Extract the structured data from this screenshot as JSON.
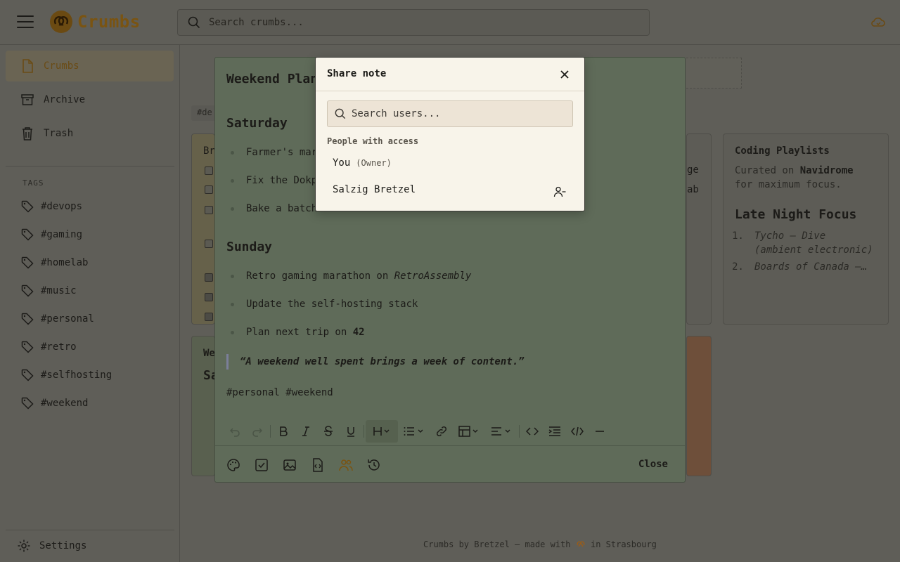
{
  "app": {
    "name": "Crumbs",
    "search_placeholder": "Search crumbs..."
  },
  "sidebar": {
    "items": [
      {
        "label": "Crumbs",
        "icon": "note-icon"
      },
      {
        "label": "Archive",
        "icon": "archive-icon"
      },
      {
        "label": "Trash",
        "icon": "trash-icon"
      }
    ],
    "tags_heading": "TAGS",
    "tags": [
      "#devops",
      "#gaming",
      "#homelab",
      "#music",
      "#personal",
      "#retro",
      "#selfhosting",
      "#weekend"
    ],
    "settings_label": "Settings"
  },
  "background": {
    "chip": "#de",
    "yellow_peek": "Br",
    "green_peek_1": "We",
    "green_peek_2": "Sa",
    "grey_peek_1": "ge",
    "grey_peek_2": "ab",
    "coding": {
      "title": "Coding Playlists",
      "sub_before": "Curated on ",
      "sub_bold": "Navidrome",
      "sub_after": " for maximum focus.",
      "heading": "Late Night Focus",
      "items": [
        {
          "num": "1.",
          "text": "Tycho — Dive (ambient electronic)"
        },
        {
          "num": "2.",
          "text": "Boards of Canada —…"
        }
      ]
    }
  },
  "editor": {
    "title": "Weekend Plans",
    "saturday_heading": "Saturday",
    "saturday_items": [
      "Farmer's market",
      "Fix the Dokploy",
      "Bake a batch"
    ],
    "sunday_heading": "Sunday",
    "sunday_items": [
      {
        "text": "Retro gaming marathon on ",
        "em": "RetroAssembly"
      },
      {
        "text": "Update the self-hosting stack",
        "em": ""
      },
      {
        "text": "Plan next trip on ",
        "bold": "42"
      }
    ],
    "quote": "“A weekend well spent brings a week of content.”",
    "tags_line": "#personal #weekend",
    "close_label": "Close"
  },
  "share_modal": {
    "title": "Share note",
    "search_placeholder": "Search users...",
    "access_label": "People with access",
    "people": [
      {
        "name": "You",
        "role": "(Owner)"
      },
      {
        "name": "Salzig Bretzel",
        "role": ""
      }
    ]
  },
  "footer": {
    "before": "Crumbs by Bretzel — made with ",
    "after": " in Strasbourg"
  },
  "colors": {
    "accent": "#7a5412",
    "modal_bg": "#f8f4ea",
    "editor_bg": "#5f6b59"
  }
}
